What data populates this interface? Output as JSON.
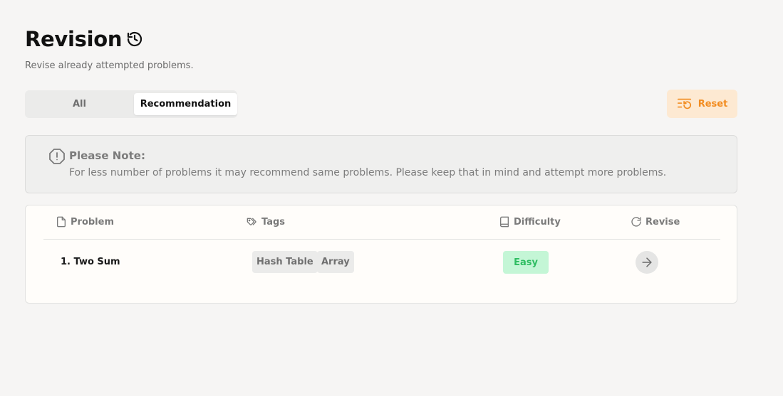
{
  "header": {
    "title": "Revision",
    "title_icon": "history-icon",
    "subtitle": "Revise already attempted problems."
  },
  "tabs": [
    {
      "label": "All",
      "active": false
    },
    {
      "label": "Recommendation",
      "active": true
    }
  ],
  "reset_button": {
    "label": "Reset",
    "icon": "reset-list-icon",
    "color": "#f28c20",
    "background": "#fde9d2"
  },
  "note": {
    "icon": "alert-octagon-icon",
    "title": "Please Note:",
    "text": "For less number of problems it may recommend same problems. Please keep that in mind and attempt more problems."
  },
  "table": {
    "columns": [
      {
        "label": "Problem",
        "icon": "file-icon"
      },
      {
        "label": "Tags",
        "icon": "tags-icon"
      },
      {
        "label": "Difficulty",
        "icon": "book-icon"
      },
      {
        "label": "Revise",
        "icon": "refresh-icon"
      }
    ],
    "rows": [
      {
        "problem": "1. Two Sum",
        "tags": [
          "Hash Table",
          "Array"
        ],
        "difficulty": "Easy",
        "difficulty_color": "#2fbd62",
        "action_icon": "arrow-right-icon"
      }
    ]
  }
}
